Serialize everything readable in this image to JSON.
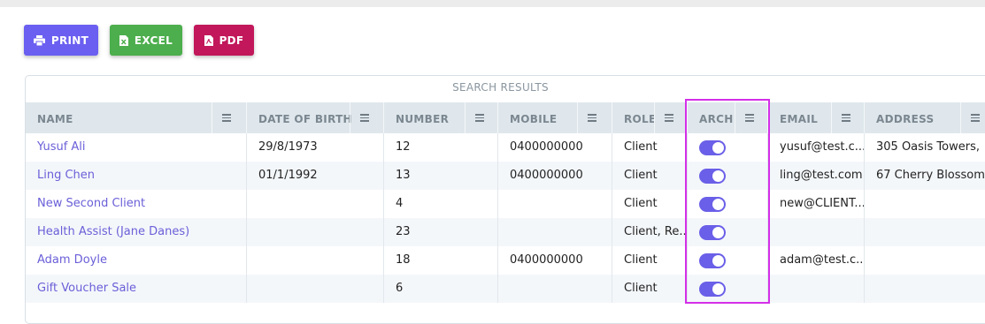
{
  "toolbar": {
    "print_label": "PRINT",
    "excel_label": "EXCEL",
    "pdf_label": "PDF"
  },
  "panel": {
    "title": "SEARCH RESULTS"
  },
  "columns": [
    {
      "label": "NAME"
    },
    {
      "label": "DATE OF BIRTH"
    },
    {
      "label": "NUMBER"
    },
    {
      "label": "MOBILE"
    },
    {
      "label": "ROLE"
    },
    {
      "label": "ARCH"
    },
    {
      "label": "EMAIL"
    },
    {
      "label": "ADDRESS"
    }
  ],
  "rows": [
    {
      "name": "Yusuf Ali",
      "dob": "29/8/1973",
      "number": "12",
      "mobile": "0400000000",
      "role": "Client",
      "archived": true,
      "email": "yusuf@test.c...",
      "address": "305 Oasis Towers,"
    },
    {
      "name": "Ling Chen",
      "dob": "01/1/1992",
      "number": "13",
      "mobile": "0400000000",
      "role": "Client",
      "archived": true,
      "email": "ling@test.com",
      "address": "67 Cherry Blossom"
    },
    {
      "name": "New Second Client",
      "dob": "",
      "number": "4",
      "mobile": "",
      "role": "Client",
      "archived": true,
      "email": "new@CLIENT....",
      "address": ""
    },
    {
      "name": "Health Assist (Jane Danes)",
      "dob": "",
      "number": "23",
      "mobile": "",
      "role": "Client, Re...",
      "archived": true,
      "email": "",
      "address": ""
    },
    {
      "name": "Adam Doyle",
      "dob": "",
      "number": "18",
      "mobile": "0400000000",
      "role": "Client",
      "archived": true,
      "email": "adam@test.c...",
      "address": ""
    },
    {
      "name": "Gift Voucher Sale",
      "dob": "",
      "number": "6",
      "mobile": "",
      "role": "Client",
      "archived": true,
      "email": "",
      "address": ""
    }
  ],
  "colors": {
    "accent": "#6a5ff0",
    "excel": "#4cae4c",
    "pdf": "#c2185b",
    "highlight": "#d42fe8"
  }
}
